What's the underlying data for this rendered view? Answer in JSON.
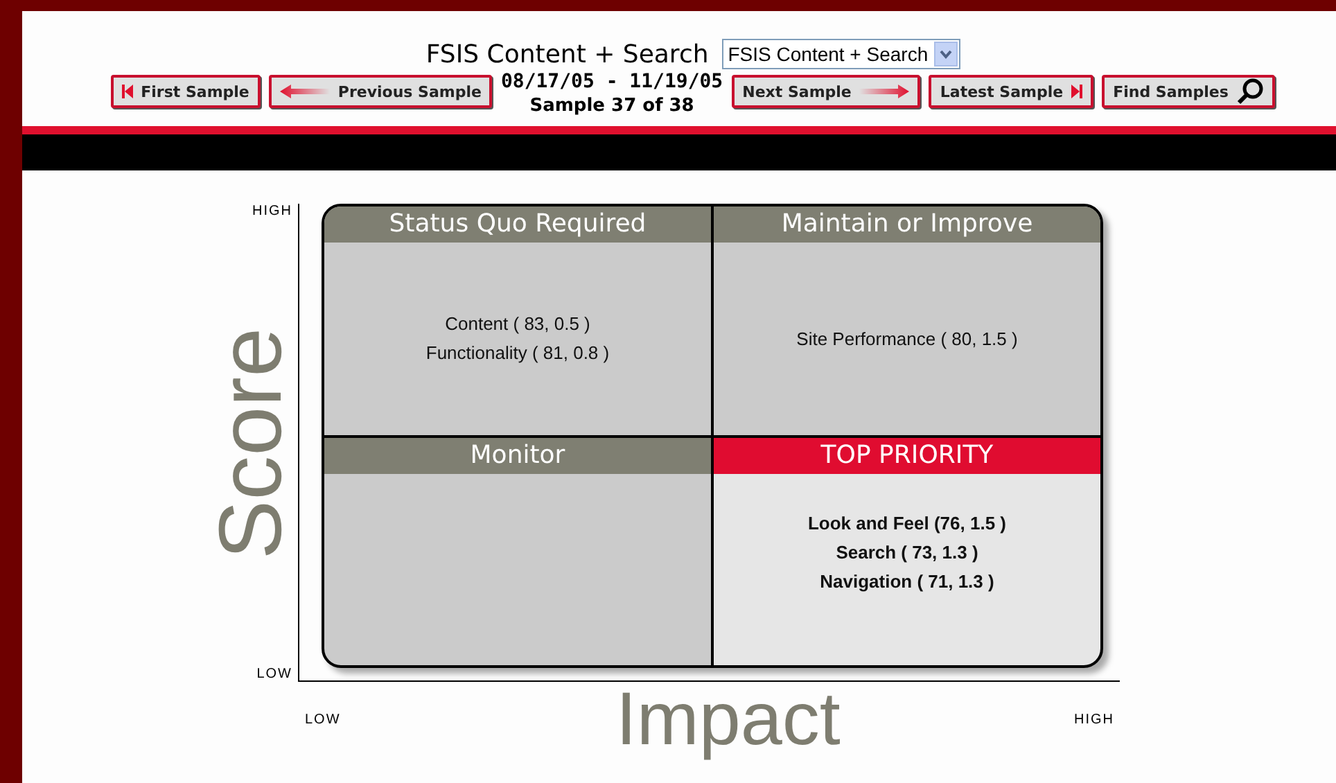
{
  "header": {
    "title": "FSIS Content + Search",
    "select": {
      "value": "FSIS Content + Search"
    },
    "date_range": "08/17/05 - 11/19/05",
    "sample": "Sample 37 of 38"
  },
  "buttons": [
    {
      "label": "First Sample",
      "kind": "first"
    },
    {
      "label": "Previous Sample",
      "kind": "previous"
    },
    {
      "label": "Next Sample",
      "kind": "next"
    },
    {
      "label": "Latest Sample",
      "kind": "latest"
    },
    {
      "label": "Find Samples",
      "kind": "find"
    }
  ],
  "matrix": {
    "y_axis": {
      "title": "Score",
      "high": "HIGH",
      "low": "LOW"
    },
    "x_axis": {
      "title": "Impact",
      "high": "HIGH",
      "low": "LOW"
    },
    "quadrants": [
      {
        "title": "Status Quo Required",
        "kind": "normal",
        "items": [
          "Content ( 83, 0.5 )",
          "Functionality ( 81, 0.8 )"
        ]
      },
      {
        "title": "Maintain or Improve",
        "kind": "normal",
        "items": [
          "Site Performance ( 80, 1.5 )"
        ]
      },
      {
        "title": "Monitor",
        "kind": "normal"
      },
      {
        "title": "TOP PRIORITY",
        "kind": "priority",
        "items": [
          "Look and Feel (76, 1.5 )",
          "Search ( 73, 1.3 )",
          "Navigation ( 71, 1.3 )"
        ]
      }
    ]
  }
}
